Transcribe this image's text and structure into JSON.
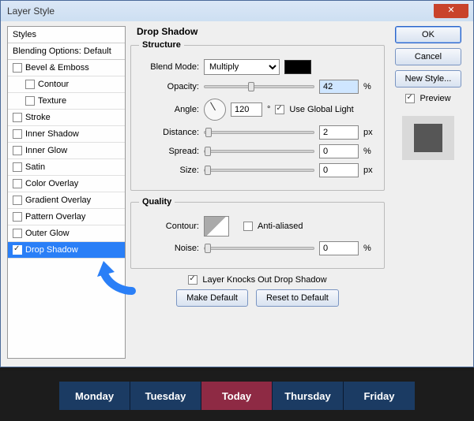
{
  "window": {
    "title": "Layer Style"
  },
  "styles": {
    "header": "Styles",
    "blending": "Blending Options: Default",
    "items": {
      "bevel": "Bevel & Emboss",
      "contour": "Contour",
      "texture": "Texture",
      "stroke": "Stroke",
      "innerShadow": "Inner Shadow",
      "innerGlow": "Inner Glow",
      "satin": "Satin",
      "colorOverlay": "Color Overlay",
      "gradientOverlay": "Gradient Overlay",
      "patternOverlay": "Pattern Overlay",
      "outerGlow": "Outer Glow",
      "dropShadow": "Drop Shadow"
    }
  },
  "panel": {
    "title": "Drop Shadow",
    "structure": "Structure",
    "blendModeLabel": "Blend Mode:",
    "blendModeValue": "Multiply",
    "opacityLabel": "Opacity:",
    "opacityValue": "42",
    "opacityUnit": "%",
    "angleLabel": "Angle:",
    "angleValue": "120",
    "angleUnit": "°",
    "useGlobal": "Use Global Light",
    "distanceLabel": "Distance:",
    "distanceValue": "2",
    "distanceUnit": "px",
    "spreadLabel": "Spread:",
    "spreadValue": "0",
    "spreadUnit": "%",
    "sizeLabel": "Size:",
    "sizeValue": "0",
    "sizeUnit": "px",
    "quality": "Quality",
    "contourLabel": "Contour:",
    "antiAliased": "Anti-aliased",
    "noiseLabel": "Noise:",
    "noiseValue": "0",
    "noiseUnit": "%",
    "knockout": "Layer Knocks Out Drop Shadow",
    "makeDefault": "Make Default",
    "resetDefault": "Reset to Default",
    "colors": {
      "shadow": "#000000"
    }
  },
  "buttons": {
    "ok": "OK",
    "cancel": "Cancel",
    "newStyle": "New Style...",
    "preview": "Preview"
  },
  "tabs": {
    "items": [
      "Monday",
      "Tuesday",
      "Today",
      "Thursday",
      "Friday"
    ]
  }
}
